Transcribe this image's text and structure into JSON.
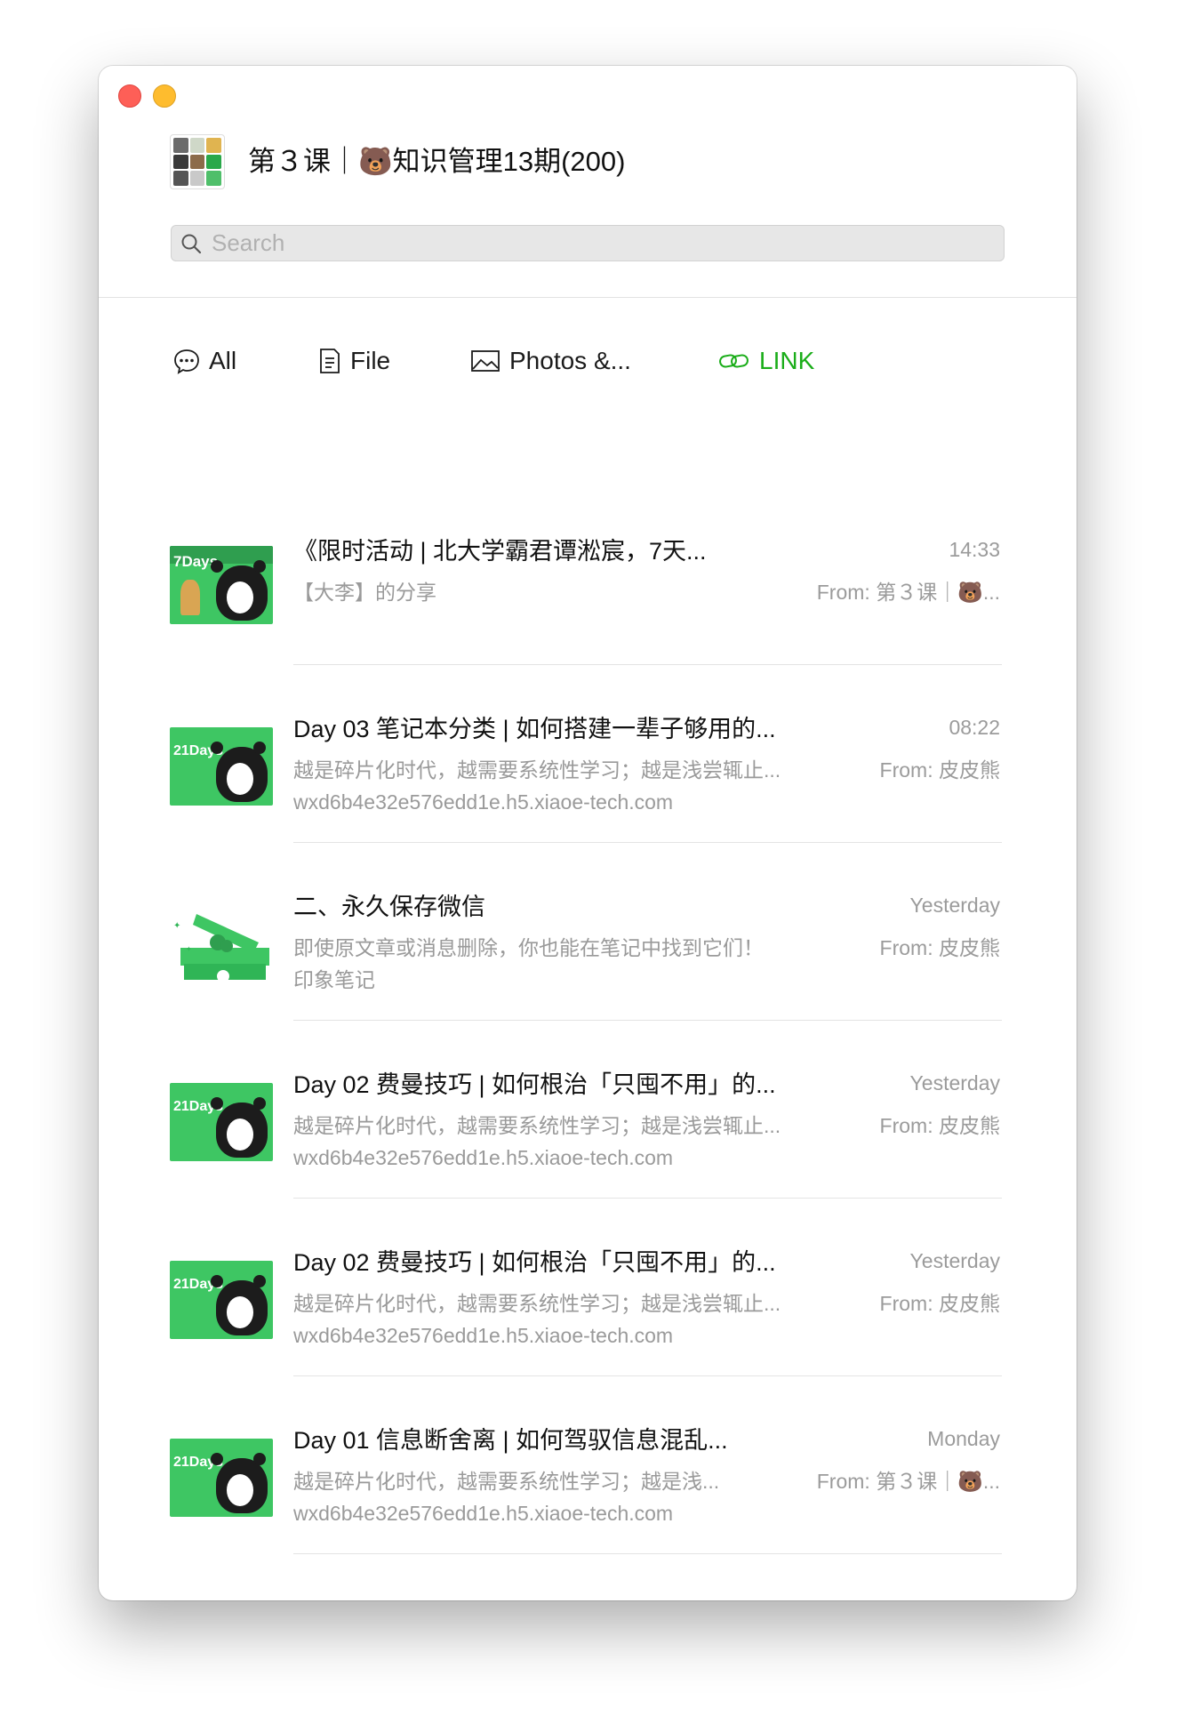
{
  "window": {
    "title": "第３课｜🐻知识管理13期(200)"
  },
  "search": {
    "placeholder": "Search"
  },
  "tabs": [
    {
      "label": "All",
      "icon": "chat-bubble-icon"
    },
    {
      "label": "File",
      "icon": "document-icon"
    },
    {
      "label": "Photos &...",
      "icon": "image-icon"
    },
    {
      "label": "LINK",
      "icon": "link-icon"
    }
  ],
  "colors": {
    "accent": "#1aad19",
    "thumb_green": "#3ec663"
  },
  "items": [
    {
      "title": "《限时活动 | 北大学霸君谭淞宸，7天...",
      "subtitle": "【大李】的分享",
      "time": "14:33",
      "from": "From: 第３课｜🐻...",
      "thumb_text": "7Days"
    },
    {
      "title": "Day 03 笔记本分类 | 如何搭建一辈子够用的...",
      "subtitle": "越是碎片化时代，越需要系统性学习；越是浅尝辄止...",
      "url": "wxd6b4e32e576edd1e.h5.xiaoe-tech.com",
      "time": "08:22",
      "from": "From: 皮皮熊",
      "thumb_text": "21Days"
    },
    {
      "title": "二、永久保存微信",
      "subtitle": "即使原文章或消息删除，你也能在笔记中找到它们！",
      "url": "印象笔记",
      "time": "Yesterday",
      "from": "From: 皮皮熊"
    },
    {
      "title": "Day 02 费曼技巧 | 如何根治「只囤不用」的...",
      "subtitle": "越是碎片化时代，越需要系统性学习；越是浅尝辄止...",
      "url": "wxd6b4e32e576edd1e.h5.xiaoe-tech.com",
      "time": "Yesterday",
      "from": "From: 皮皮熊",
      "thumb_text": "21Days"
    },
    {
      "title": "Day 02 费曼技巧 | 如何根治「只囤不用」的...",
      "subtitle": "越是碎片化时代，越需要系统性学习；越是浅尝辄止...",
      "url": "wxd6b4e32e576edd1e.h5.xiaoe-tech.com",
      "time": "Yesterday",
      "from": "From: 皮皮熊",
      "thumb_text": "21Days"
    },
    {
      "title": "Day 01 信息断舍离 | 如何驾驭信息混乱...",
      "subtitle": "越是碎片化时代，越需要系统性学习；越是浅...",
      "url": "wxd6b4e32e576edd1e.h5.xiaoe-tech.com",
      "time": "Monday",
      "from": "From: 第３课｜🐻...",
      "thumb_text": "21Days"
    }
  ]
}
